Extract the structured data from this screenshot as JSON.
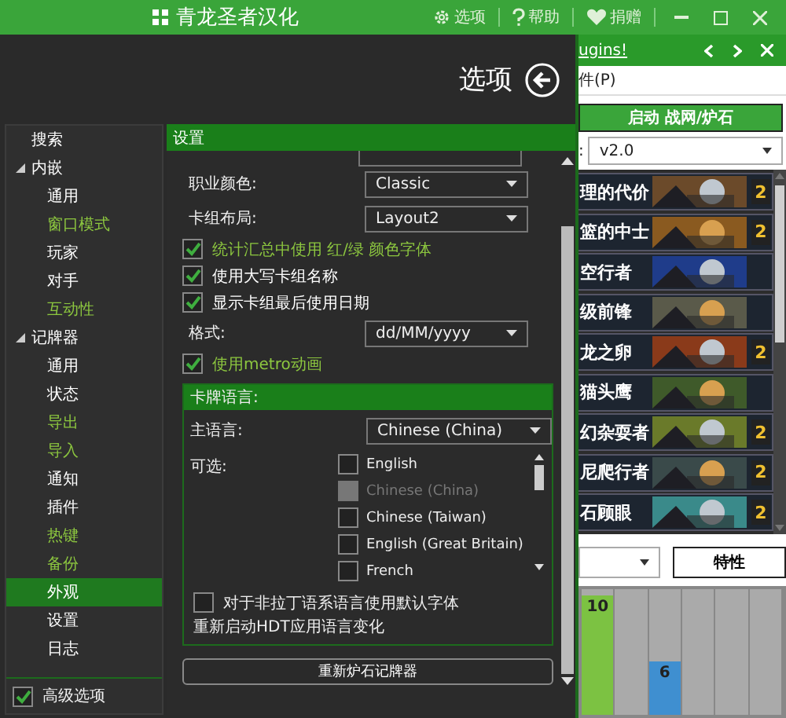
{
  "title_bar": {
    "title": "青龙圣者汉化",
    "menu": [
      {
        "kind": "gear",
        "label": "选项"
      },
      {
        "kind": "help",
        "label": "帮助"
      },
      {
        "kind": "heart",
        "label": "捐赠"
      }
    ]
  },
  "options": {
    "title": "选项",
    "sidebar": {
      "items": [
        {
          "label": "搜索",
          "color": "#ffffff",
          "selected": false
        },
        {
          "label": "内嵌",
          "expanded": true,
          "color": "#ffffff",
          "selected": false,
          "children": [
            {
              "label": "通用",
              "color": "#ffffff",
              "selected": false
            },
            {
              "label": "窗口模式",
              "color": "#8cc63f",
              "selected": false
            },
            {
              "label": "玩家",
              "color": "#ffffff",
              "selected": false
            },
            {
              "label": "对手",
              "color": "#ffffff",
              "selected": false
            },
            {
              "label": "互动性",
              "color": "#8cc63f",
              "selected": false
            }
          ]
        },
        {
          "label": "记牌器",
          "expanded": true,
          "color": "#ffffff",
          "selected": false,
          "children": [
            {
              "label": "通用",
              "color": "#ffffff",
              "selected": false
            },
            {
              "label": "状态",
              "color": "#ffffff",
              "selected": false
            },
            {
              "label": "导出",
              "color": "#8cc63f",
              "selected": false
            },
            {
              "label": "导入",
              "color": "#8cc63f",
              "selected": false
            },
            {
              "label": "通知",
              "color": "#ffffff",
              "selected": false
            },
            {
              "label": "插件",
              "color": "#ffffff",
              "selected": false
            },
            {
              "label": "热键",
              "color": "#8cc63f",
              "selected": false
            },
            {
              "label": "备份",
              "color": "#8cc63f",
              "selected": false
            },
            {
              "label": "外观",
              "color": "#ffffff",
              "selected": true
            },
            {
              "label": "设置",
              "color": "#ffffff",
              "selected": false
            },
            {
              "label": "日志",
              "color": "#ffffff",
              "selected": false
            }
          ]
        }
      ],
      "advanced": {
        "label": "高级选项",
        "checked": true
      }
    },
    "panel_title": "设置",
    "rows": [
      {
        "kind": "select",
        "label": "职业颜色:",
        "value": "Classic"
      },
      {
        "kind": "select",
        "label": "卡组布局:",
        "value": "Layout2"
      },
      {
        "kind": "check",
        "label": "统计汇总中使用 红/绿 颜色字体",
        "checked": true,
        "color": "#8cc63f"
      },
      {
        "kind": "check",
        "label": "使用大写卡组名称",
        "checked": true,
        "color": "#ffffff"
      },
      {
        "kind": "check",
        "label": "显示卡组最后使用日期",
        "checked": true,
        "color": "#ffffff"
      },
      {
        "kind": "select",
        "label": "格式:",
        "value": "dd/MM/yyyy"
      },
      {
        "kind": "check",
        "label": "使用metro动画",
        "checked": true,
        "color": "#8cc63f"
      }
    ],
    "language": {
      "title": "卡牌语言:",
      "main_label": "主语言:",
      "main_value": "Chinese (China)",
      "alt_label": "可选:",
      "options": [
        {
          "label": "English",
          "checked": false,
          "disabled": false
        },
        {
          "label": "Chinese (China)",
          "checked": false,
          "disabled": true
        },
        {
          "label": "Chinese (Taiwan)",
          "checked": false,
          "disabled": false
        },
        {
          "label": "English (Great Britain)",
          "checked": false,
          "disabled": false
        },
        {
          "label": "French",
          "checked": false,
          "disabled": false
        }
      ],
      "font_option": {
        "label": "对于非拉丁语系语言使用默认字体",
        "checked": false
      },
      "note": "重新启动HDT应用语言变化"
    },
    "restart_button": "重新炉石记牌器"
  },
  "tracker": {
    "link": "ugins!",
    "menu": "件(P)",
    "launch_button": "启动 战网/炉石",
    "deck_label": ":",
    "deck_version": "v2.0",
    "cards": [
      {
        "name": "理的代价",
        "count": "2"
      },
      {
        "name": "篮的中士",
        "count": "2"
      },
      {
        "name": "空行者"
      },
      {
        "name": "级前锋"
      },
      {
        "name": "龙之卵",
        "count": "2"
      },
      {
        "name": "猫头鹰"
      },
      {
        "name": "幻杂耍者",
        "count": "2"
      },
      {
        "name": "尼爬行者",
        "count": "2"
      },
      {
        "name": "石顾眼",
        "count": "2"
      }
    ],
    "stats_button": "特性",
    "mana_curve": [
      {
        "kind": "bar",
        "label": "10",
        "level": 1,
        "color": "#7cc242"
      },
      {
        "kind": "empty"
      },
      {
        "kind": "bar",
        "label": "6",
        "level": 0.45,
        "color": "#3f8fd0"
      },
      {
        "kind": "empty"
      },
      {
        "kind": "empty"
      },
      {
        "kind": "empty"
      }
    ]
  }
}
